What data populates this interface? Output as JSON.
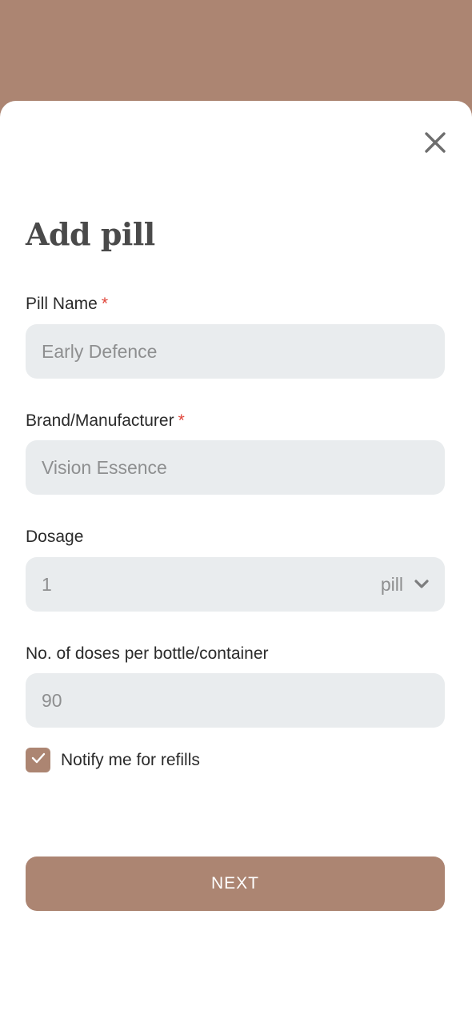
{
  "form": {
    "title": "Add pill",
    "required_marker": "*",
    "pill_name": {
      "label": "Pill Name",
      "value": "Early Defence"
    },
    "brand": {
      "label": "Brand/Manufacturer",
      "value": "Vision Essence"
    },
    "dosage": {
      "label": "Dosage",
      "value": "1",
      "unit": "pill"
    },
    "doses_per_container": {
      "label": "No. of doses per bottle/container",
      "value": "90"
    },
    "notify_refills": {
      "label": "Notify me for refills",
      "checked": true
    },
    "next_label": "NEXT"
  },
  "icons": {
    "close": "close-icon",
    "dosage_dropdown": "chevron-down-icon",
    "checkbox_check": "checkmark-icon"
  },
  "colors": {
    "accent": "#ac8572",
    "field_bg": "#e9ecee",
    "required": "#e0453a",
    "title_text": "#4a4a4a",
    "value_text": "#8e8f90"
  }
}
